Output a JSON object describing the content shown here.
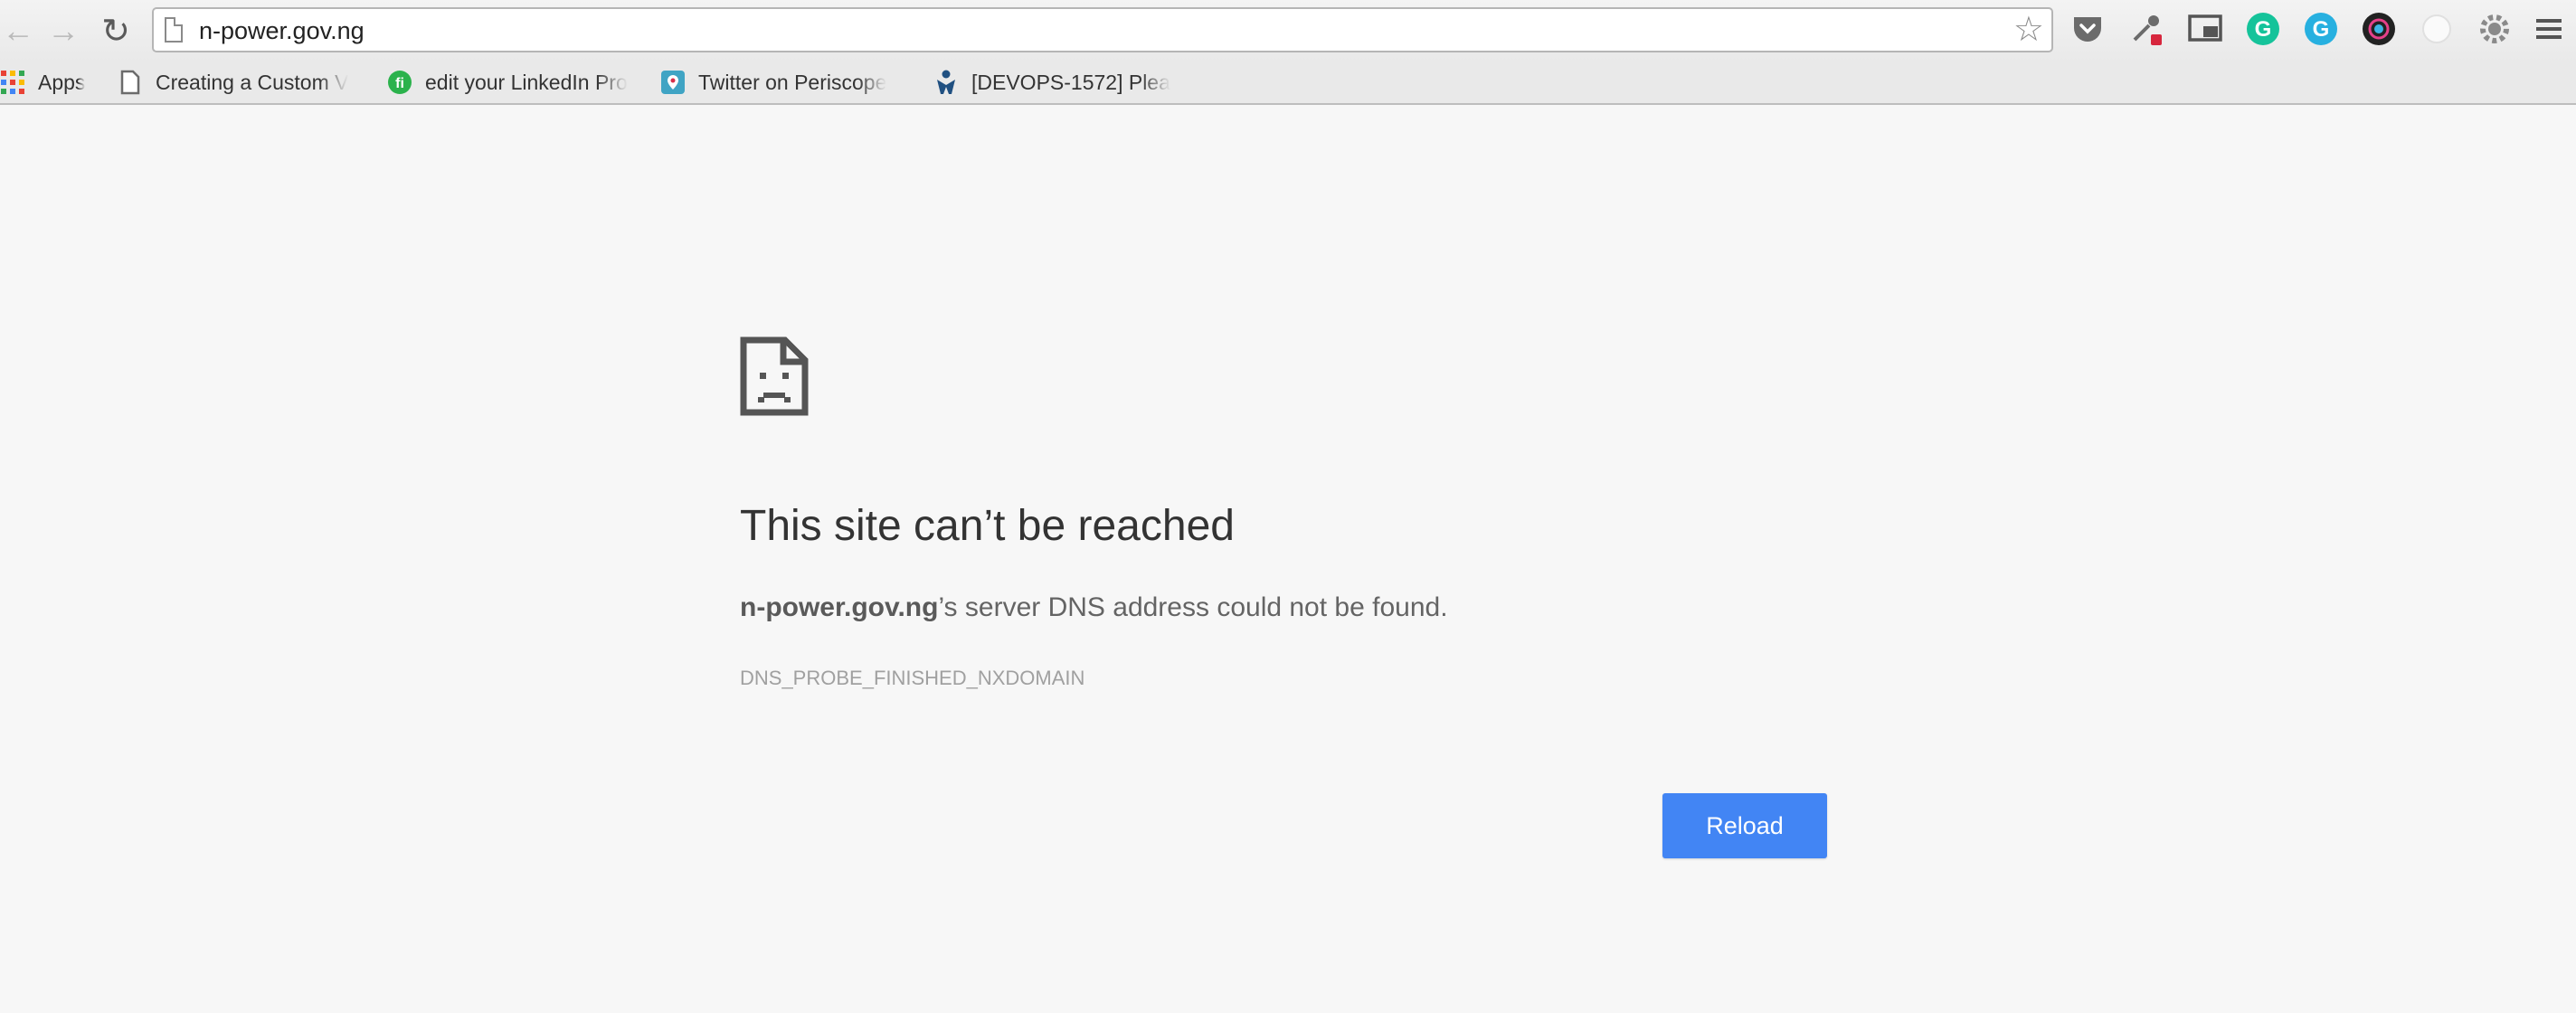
{
  "browser": {
    "url": "n-power.gov.ng",
    "bookmarks": [
      {
        "label": "Apps",
        "icon": "apps-grid-icon"
      },
      {
        "label": "Creating a Custom V",
        "icon": "page-icon"
      },
      {
        "label": "edit your LinkedIn Pro",
        "icon": "green-badge-icon"
      },
      {
        "label": "Twitter on Periscope",
        "icon": "periscope-icon"
      },
      {
        "label": "[DEVOPS-1572] Plea",
        "icon": "jira-icon"
      }
    ],
    "extensions": [
      "pocket-icon",
      "color-picker-icon",
      "cast-icon",
      "grammarly-icon",
      "grammarly-alt-icon",
      "camera-icon",
      "blank-extension-icon",
      "settings-gear-icon",
      "menu-icon"
    ]
  },
  "error": {
    "title": "This site can’t be reached",
    "host": "n-power.gov.ng",
    "message_suffix": "’s server DNS address could not be found.",
    "code": "DNS_PROBE_FINISHED_NXDOMAIN",
    "reload_label": "Reload"
  },
  "colors": {
    "accent": "#4285f4",
    "page_background": "#f7f7f7",
    "title_text": "#333333"
  }
}
